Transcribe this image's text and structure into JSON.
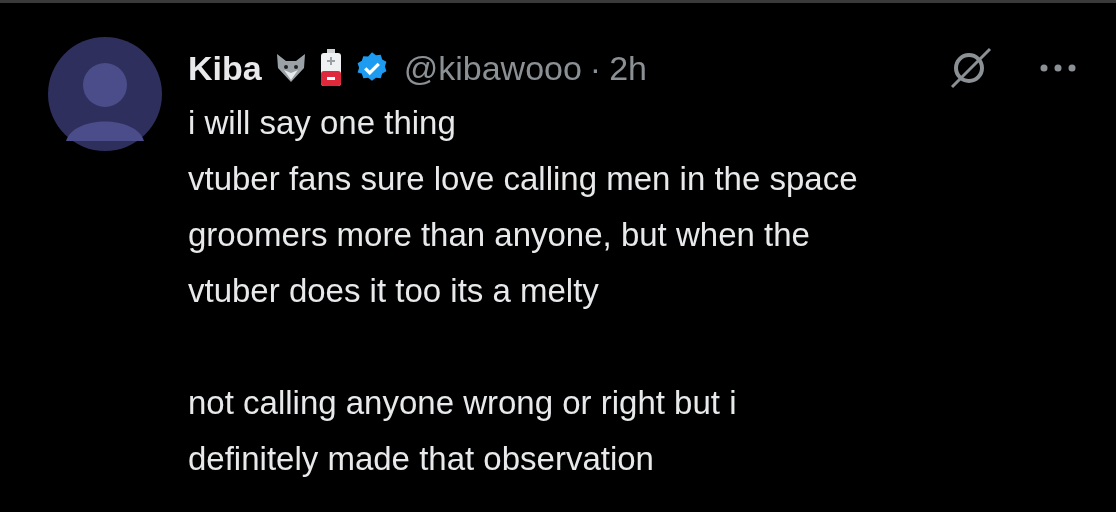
{
  "post": {
    "display_name": "Kiba",
    "verified": true,
    "handle": "@kibawooo",
    "separator": "·",
    "time": "2h",
    "paragraphs": [
      "i will say one thing\nvtuber fans sure love calling men in the space\ngroomers more than anyone, but when the\nvtuber does it too its a melty",
      "not calling anyone wrong or right but i\ndefinitely made that observation"
    ]
  }
}
